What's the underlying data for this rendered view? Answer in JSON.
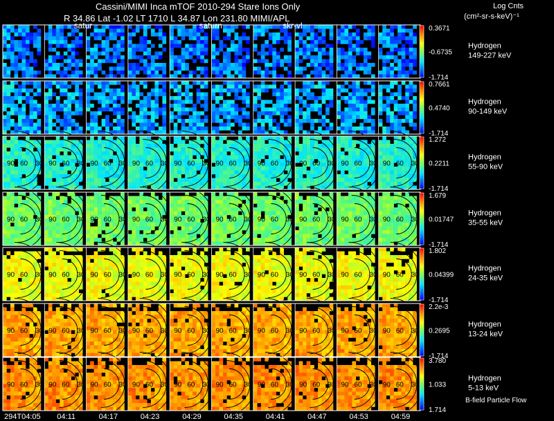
{
  "header": {
    "title": "Cassini/MIMI Inca mTOF  2010-294   Stare    Ions Only",
    "subtitle": "R      34.86 Lat -1.02 LT 1710 L         34.87 Lon       231.80   MIMI/APL",
    "colorbar_title": "Log Cnts",
    "colorbar_units": "(cm²-sr-s-keV)⁻¹",
    "footer_note": "B-field Particle Flow"
  },
  "frame_labels": [
    {
      "text": "satur",
      "frame": 2
    },
    {
      "text": "saturn",
      "frame": 5
    },
    {
      "text": "skr-vl",
      "frame": 7
    }
  ],
  "time_labels": [
    "294T04:05",
    "04:11",
    "04:17",
    "04:23",
    "04:29",
    "04:35",
    "04:41",
    "04:47",
    "04:53",
    "04:59"
  ],
  "arc_labels": [
    "90",
    "60",
    "30"
  ],
  "chart_data": {
    "type": "heatmap",
    "title": "Cassini/MIMI Inca mTOF  2010-294   Stare    Ions Only",
    "frames_per_row": 10,
    "bands": [
      {
        "species": "Hydrogen",
        "energy": "149-227 keV",
        "max": "0.3671",
        "mid": "-0.6735",
        "min": "-1.714",
        "level": 0.18,
        "arcs": false
      },
      {
        "species": "Hydrogen",
        "energy": "90-149 keV",
        "max": "0.7661",
        "mid": "0.4740",
        "min": "-1.714",
        "level": 0.24,
        "arcs": false
      },
      {
        "species": "Hydrogen",
        "energy": "55-90 keV",
        "max": "1.272",
        "mid": "0.2211",
        "min": "-1.714",
        "level": 0.38,
        "arcs": true
      },
      {
        "species": "Hydrogen",
        "energy": "35-55 keV",
        "max": "1.679",
        "mid": "0.01747",
        "min": "-1.714",
        "level": 0.5,
        "arcs": true
      },
      {
        "species": "Hydrogen",
        "energy": "24-35 keV",
        "max": "1.802",
        "mid": "0.04399",
        "min": "-1.714",
        "level": 0.66,
        "arcs": true
      },
      {
        "species": "Hydrogen",
        "energy": "13-24 keV",
        "max": "2.2e-3",
        "mid": "0.2695",
        "min": "-1.714",
        "level": 0.8,
        "arcs": true
      },
      {
        "species": "Hydrogen",
        "energy": "5-13 keV",
        "max": "3.780",
        "mid": "1.033",
        "min": "1.714",
        "level": 0.83,
        "arcs": true
      }
    ],
    "colors": {
      "low": "#0000ff",
      "mid_low": "#00ffff",
      "mid": "#ffff00",
      "high": "#ff0000",
      "grid": "#ffffff",
      "arc": "#000000"
    }
  }
}
